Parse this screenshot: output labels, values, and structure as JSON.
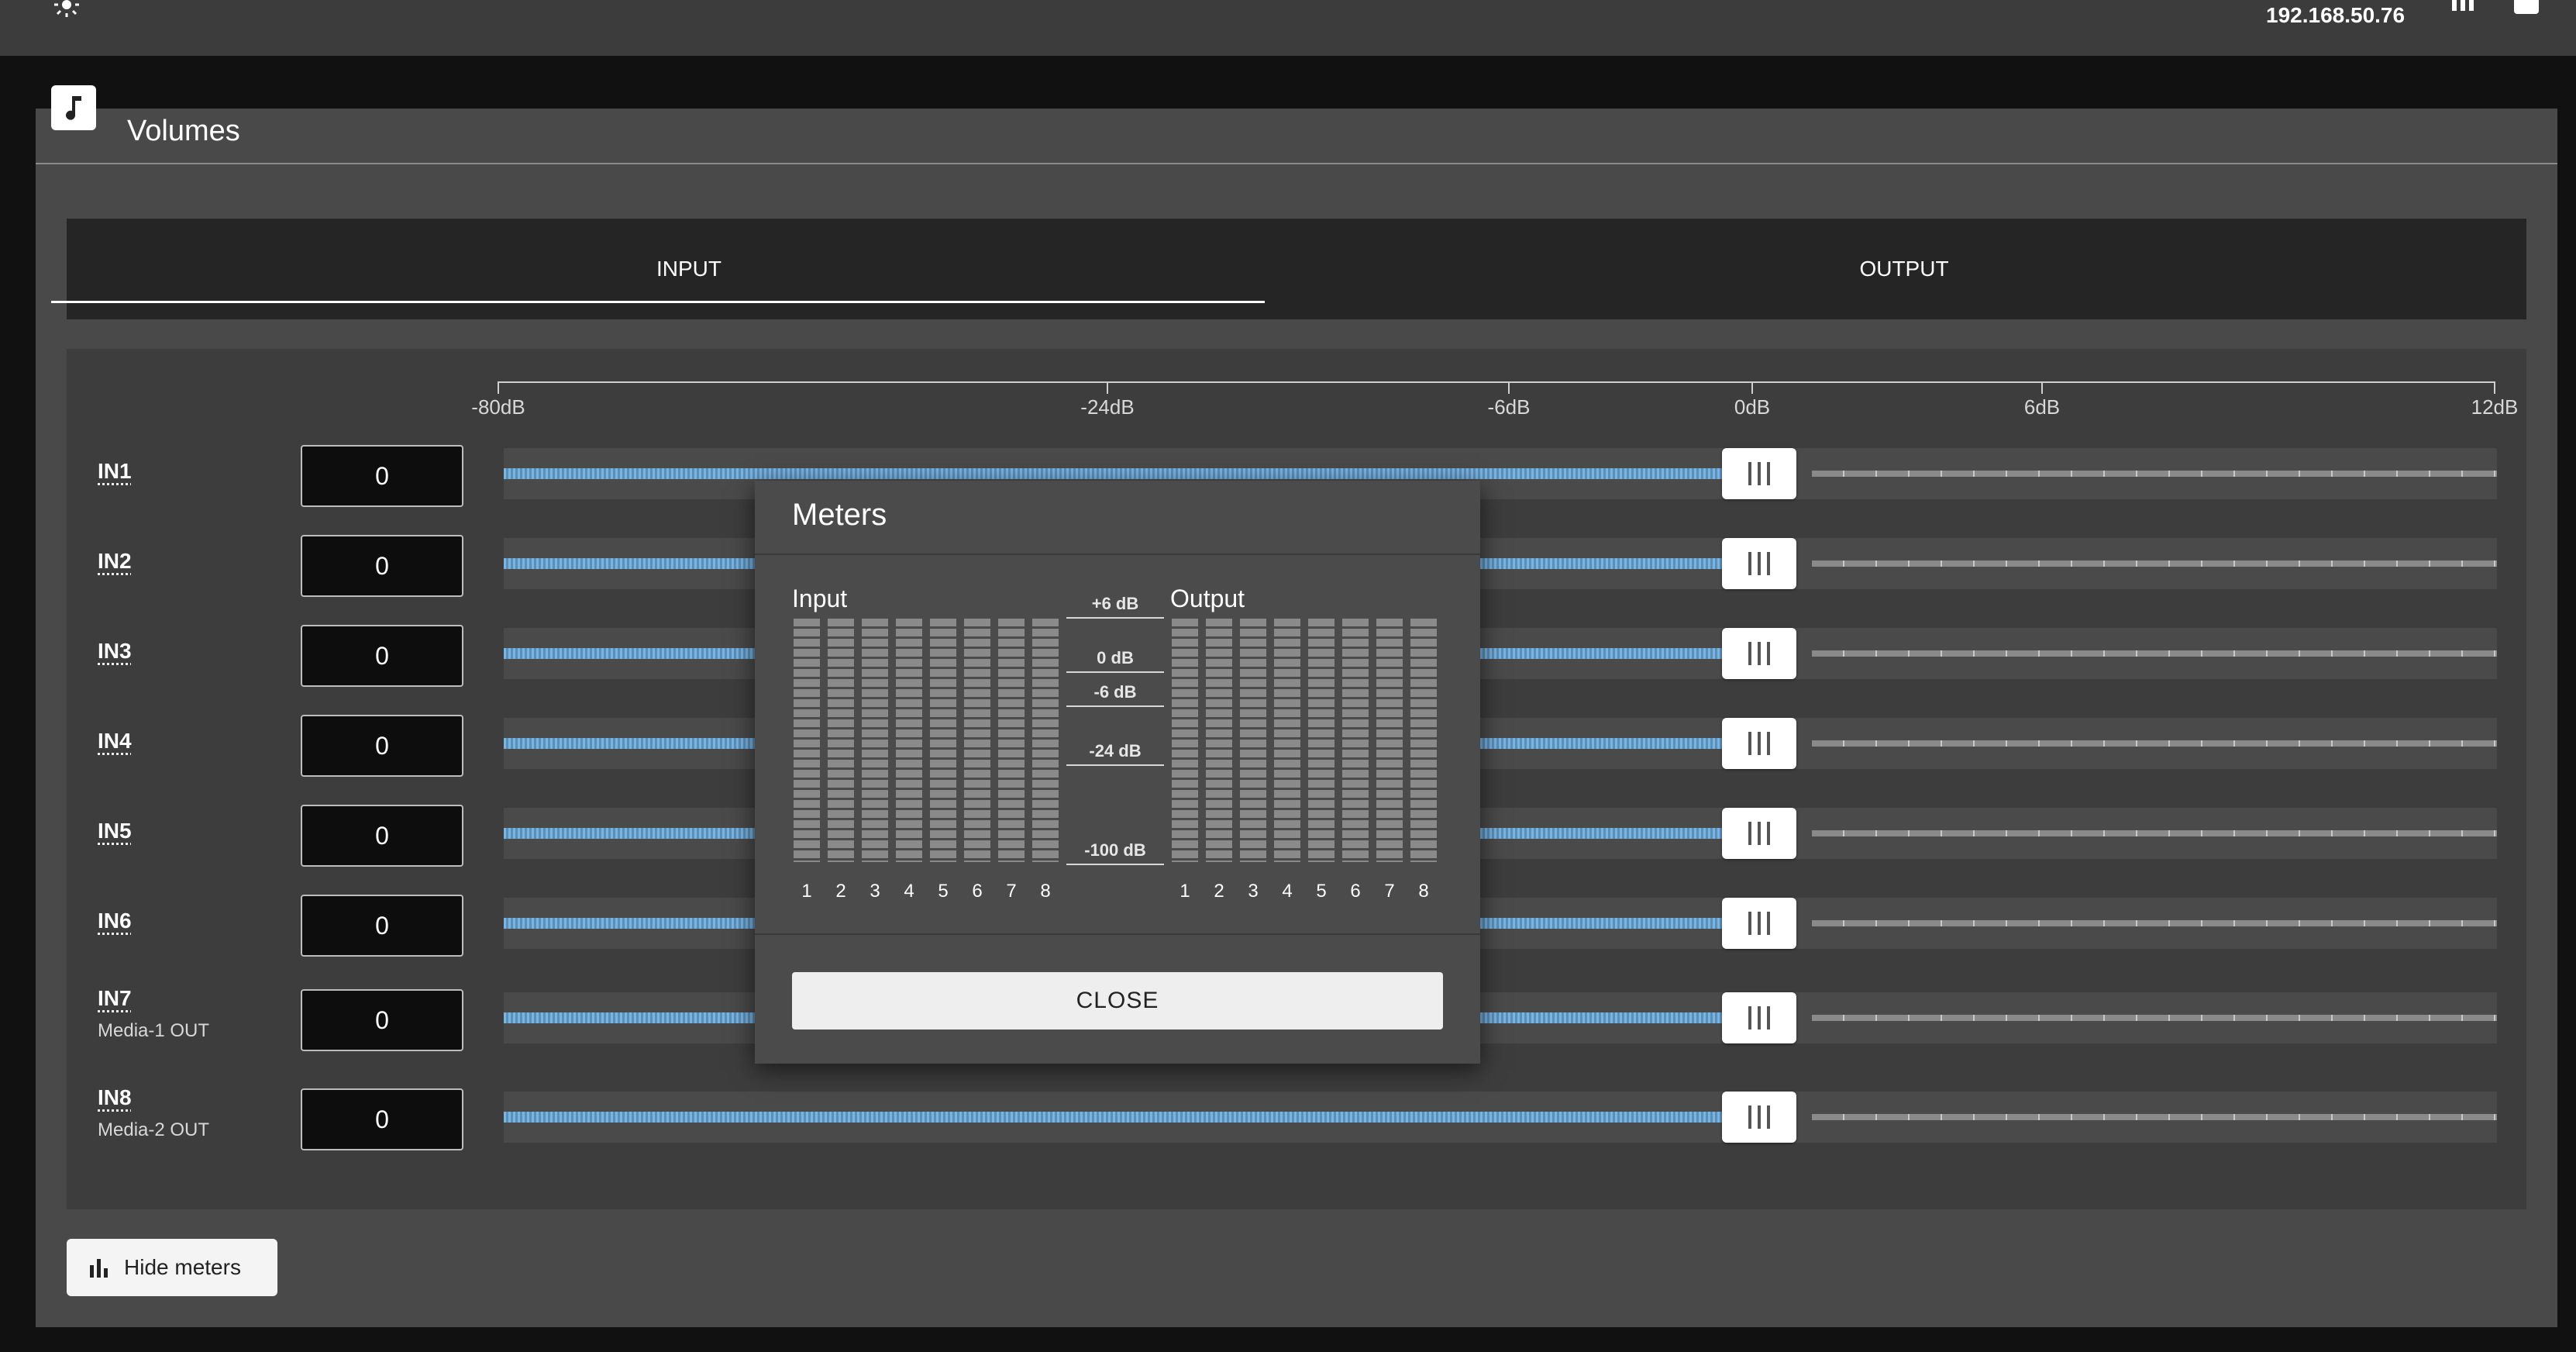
{
  "topbar": {
    "ip": "192.168.50.76",
    "icons": [
      "sun-icon",
      "bars-icon",
      "save-icon"
    ]
  },
  "card": {
    "title": "Volumes",
    "icon": "music-note-icon"
  },
  "tabs": [
    {
      "label": "INPUT",
      "active": true
    },
    {
      "label": "OUTPUT",
      "active": false
    }
  ],
  "scale": {
    "labels": [
      "-80dB",
      "-24dB",
      "-6dB",
      "0dB",
      "6dB",
      "12dB"
    ]
  },
  "rows": [
    {
      "label": "IN1",
      "sub": "",
      "value": "0"
    },
    {
      "label": "IN2",
      "sub": "",
      "value": "0"
    },
    {
      "label": "IN3",
      "sub": "",
      "value": "0"
    },
    {
      "label": "IN4",
      "sub": "",
      "value": "0"
    },
    {
      "label": "IN5",
      "sub": "",
      "value": "0"
    },
    {
      "label": "IN6",
      "sub": "",
      "value": "0"
    },
    {
      "label": "IN7",
      "sub": "Media-1 OUT",
      "value": "0"
    },
    {
      "label": "IN8",
      "sub": "Media-2 OUT",
      "value": "0"
    }
  ],
  "slider_level_db": 0,
  "hide_meters": {
    "label": "Hide meters",
    "icon": "bar-chart-icon"
  },
  "modal": {
    "title": "Meters",
    "input_label": "Input",
    "output_label": "Output",
    "channels": [
      "1",
      "2",
      "3",
      "4",
      "5",
      "6",
      "7",
      "8"
    ],
    "db_marks": [
      "+6 dB",
      "0 dB",
      "-6 dB",
      "-24 dB",
      "-100 dB"
    ],
    "close_label": "CLOSE"
  },
  "colors": {
    "accent": "#7cb4e0",
    "panel": "#3d3d3d",
    "card": "#494949"
  }
}
